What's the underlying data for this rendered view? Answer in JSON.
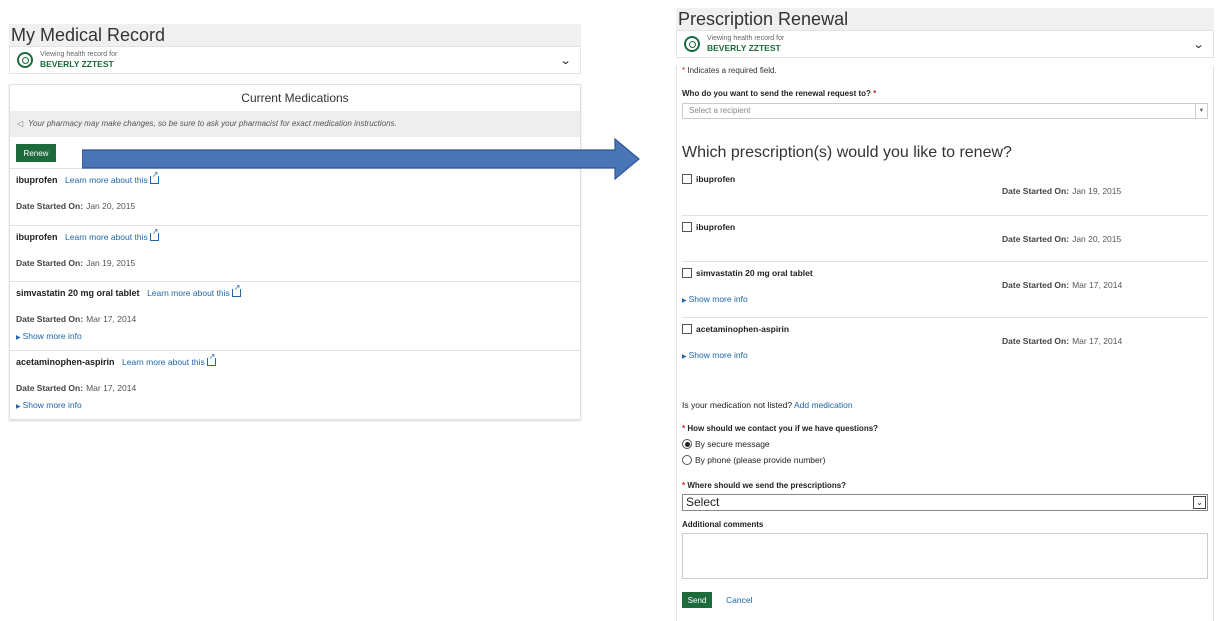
{
  "left": {
    "title": "My Medical Record",
    "patient": {
      "viewing_label": "Viewing health record for",
      "name": "BEVERLY ZZTEST"
    },
    "card_title": "Current Medications",
    "notice": "Your pharmacy may make changes, so be sure to ask your pharmacist for exact medication instructions.",
    "renew_label": "Renew",
    "learn_more": "Learn more about this",
    "date_label": "Date Started On:",
    "show_more": "Show more info",
    "medications": [
      {
        "name": "ibuprofen",
        "date": "Jan 20, 2015"
      },
      {
        "name": "ibuprofen",
        "date": "Jan 19, 2015"
      },
      {
        "name": "simvastatin 20 mg oral tablet",
        "date": "Mar 17, 2014"
      },
      {
        "name": "acetaminophen-aspirin",
        "date": "Mar 17, 2014"
      }
    ]
  },
  "right": {
    "title": "Prescription Renewal",
    "patient": {
      "viewing_label": "Viewing health record for",
      "name": "BEVERLY ZZTEST"
    },
    "required_note": "Indicates a required field.",
    "recipient_question": "Who do you want to send the renewal request to?",
    "recipient_placeholder": "Select a recipient",
    "renew_question": "Which prescription(s) would you like to renew?",
    "date_label": "Date Started On:",
    "show_more": "Show more info",
    "prescriptions": [
      {
        "name": "ibuprofen",
        "date": "Jan 19, 2015"
      },
      {
        "name": "ibuprofen",
        "date": "Jan 20, 2015"
      },
      {
        "name": "simvastatin 20 mg oral tablet",
        "date": "Mar 17, 2014"
      },
      {
        "name": "acetaminophen-aspirin",
        "date": "Mar 17, 2014"
      }
    ],
    "not_listed_text": "Is your medication not listed?",
    "add_medication": "Add medication",
    "contact_question": "How should we contact you if we have questions?",
    "contact_options": [
      "By secure message",
      "By phone (please provide number)"
    ],
    "where_question": "Where should we send the prescriptions?",
    "where_value": "Select",
    "comments_label": "Additional comments",
    "send_label": "Send",
    "cancel_label": "Cancel"
  },
  "colors": {
    "brand_green": "#1d6b3d",
    "link_blue": "#1f66a8",
    "arrow_blue": "#4a76b8",
    "required_red": "#cc2222"
  }
}
